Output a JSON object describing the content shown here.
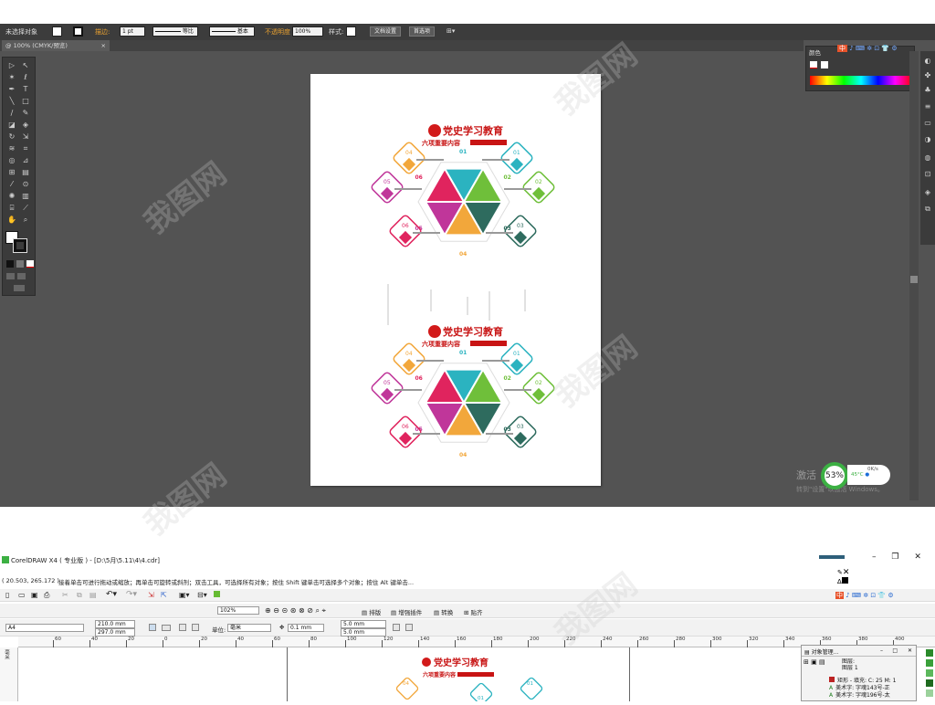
{
  "illustrator": {
    "control_bar": {
      "selection_label": "未选择对象",
      "stroke_label": "描边:",
      "stroke_weight": "1 pt",
      "stroke_style_1": "等比",
      "stroke_style_2": "基本",
      "opacity_label": "不透明度",
      "opacity_value": "100%",
      "style_label": "样式:",
      "doc_setup_button": "文档设置",
      "prefs_button": "首选项"
    },
    "document_tab": "@ 100% (CMYK/预览)",
    "color_panel_title": "颜色",
    "artwork": {
      "title": "党史学习教育",
      "subtitle": "六项重要内容",
      "hub_labels": [
        "01",
        "02",
        "03",
        "04",
        "05",
        "06"
      ],
      "diamond_labels": [
        "04",
        "01",
        "05",
        "02",
        "06",
        "03"
      ]
    },
    "activation": {
      "line1": "激活",
      "line2": "转到\"设置\"以激活 Windows。",
      "gauge_value": "53%",
      "stat1": "0K/s",
      "stat2": "0K/s",
      "temperature": "45°C"
    }
  },
  "coreldraw": {
    "title": "CorelDRAW X4 ( 专业版 ) - [D:\\5月\\5.11\\4\\4.cdr]",
    "coords": "( 20.503, 265.172 )",
    "hint": "接着单击可进行拖动或缩放；再单击可旋转或斜剂；双击工具，可选择所有对象；按住 Shift 键单击可选择多个对象；按住 Alt 键单击...",
    "zoom": "102%",
    "menu_items": [
      "排版",
      "增强插件",
      "转换",
      "贴齐"
    ],
    "page_size": "A4",
    "width": "210.0 mm",
    "height": "297.0 mm",
    "units_label": "单位:",
    "units": "毫米",
    "nudge": "0.1 mm",
    "dup_x": "5.0 mm",
    "dup_y": "5.0 mm",
    "ruler_ticks": [
      "60",
      "40",
      "20",
      "0",
      "20",
      "40",
      "60",
      "80",
      "100",
      "120",
      "140",
      "160",
      "180",
      "200",
      "220",
      "240",
      "260",
      "280",
      "300",
      "320",
      "340",
      "360",
      "380",
      "400"
    ],
    "ruler_units": "毫米",
    "object_manager": {
      "title": "对象管理...",
      "layer1": "图层:",
      "layer2": "图层 1",
      "rows": [
        "矩形 - 填充: C: 25 M: 1",
        "美术字: 字魂143号-正",
        "美术字: 字魂196号-太"
      ]
    }
  },
  "watermark": "我图网"
}
